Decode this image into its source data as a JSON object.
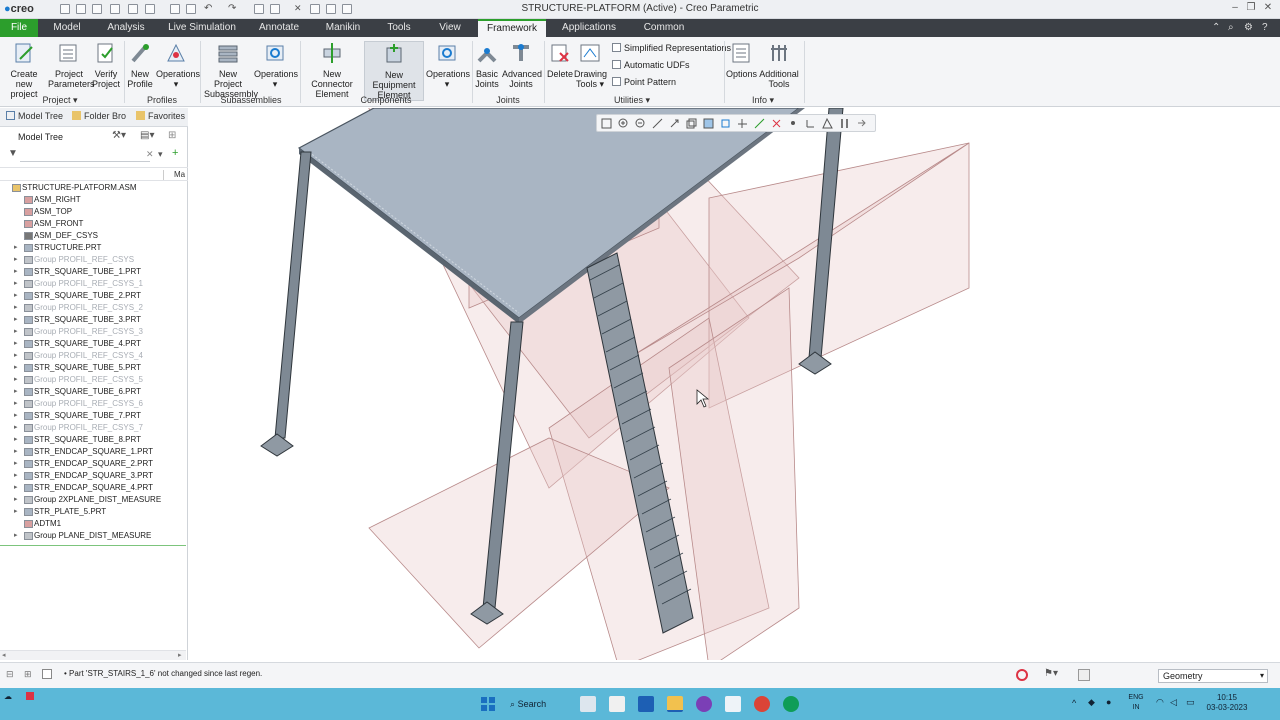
{
  "app": {
    "logo": "creo",
    "window_title": "STRUCTURE-PLATFORM (Active) - Creo Parametric"
  },
  "menu_tabs": [
    "File",
    "Model",
    "Analysis",
    "Live Simulation",
    "Annotate",
    "Manikin",
    "Tools",
    "View",
    "Framework",
    "Applications",
    "Common"
  ],
  "active_tab": "Framework",
  "ribbon": {
    "project": {
      "create_new_project": "Create new project",
      "project_parameters": "Project Parameters",
      "verify_project": "Verify Project",
      "label": "Project"
    },
    "profiles": {
      "new_profile": "New Profile",
      "operations": "Operations",
      "label": "Profiles"
    },
    "subassemblies": {
      "new_project_subassembly": "New Project Subassembly",
      "operations": "Operations",
      "label": "Subassemblies"
    },
    "components": {
      "new_connector_element": "New Connector Element",
      "new_equipment_element": "New Equipment Element",
      "operations": "Operations",
      "label": "Components"
    },
    "joints": {
      "basic_joints": "Basic Joints",
      "advanced_joints": "Advanced Joints",
      "label": "Joints"
    },
    "utilities": {
      "delete": "Delete",
      "drawing_tools": "Drawing Tools",
      "simplified_representations": "Simplified Representations",
      "automatic_udfs": "Automatic UDFs",
      "point_pattern": "Point Pattern",
      "label": "Utilities"
    },
    "info": {
      "options": "Options",
      "additional_tools": "Additional Tools",
      "label": "Info"
    }
  },
  "tree_panel": {
    "tabs": [
      "Model Tree",
      "Folder Bro",
      "Favorites"
    ],
    "header": "Model Tree",
    "column": "Ma",
    "search_value": "",
    "items": [
      {
        "label": "STRUCTURE-PLATFORM.ASM",
        "dim": false,
        "expandable": false,
        "kind": "asm"
      },
      {
        "label": "ASM_RIGHT",
        "dim": false,
        "expandable": false,
        "kind": "plane"
      },
      {
        "label": "ASM_TOP",
        "dim": false,
        "expandable": false,
        "kind": "plane"
      },
      {
        "label": "ASM_FRONT",
        "dim": false,
        "expandable": false,
        "kind": "plane"
      },
      {
        "label": "ASM_DEF_CSYS",
        "dim": false,
        "expandable": false,
        "kind": "csys"
      },
      {
        "label": "STRUCTURE.PRT",
        "dim": false,
        "expandable": true,
        "kind": "part"
      },
      {
        "label": "Group PROFIL_REF_CSYS",
        "dim": true,
        "expandable": true,
        "kind": "group"
      },
      {
        "label": "STR_SQUARE_TUBE_1.PRT",
        "dim": false,
        "expandable": true,
        "kind": "part"
      },
      {
        "label": "Group PROFIL_REF_CSYS_1",
        "dim": true,
        "expandable": true,
        "kind": "group"
      },
      {
        "label": "STR_SQUARE_TUBE_2.PRT",
        "dim": false,
        "expandable": true,
        "kind": "part"
      },
      {
        "label": "Group PROFIL_REF_CSYS_2",
        "dim": true,
        "expandable": true,
        "kind": "group"
      },
      {
        "label": "STR_SQUARE_TUBE_3.PRT",
        "dim": false,
        "expandable": true,
        "kind": "part"
      },
      {
        "label": "Group PROFIL_REF_CSYS_3",
        "dim": true,
        "expandable": true,
        "kind": "group"
      },
      {
        "label": "STR_SQUARE_TUBE_4.PRT",
        "dim": false,
        "expandable": true,
        "kind": "part"
      },
      {
        "label": "Group PROFIL_REF_CSYS_4",
        "dim": true,
        "expandable": true,
        "kind": "group"
      },
      {
        "label": "STR_SQUARE_TUBE_5.PRT",
        "dim": false,
        "expandable": true,
        "kind": "part"
      },
      {
        "label": "Group PROFIL_REF_CSYS_5",
        "dim": true,
        "expandable": true,
        "kind": "group"
      },
      {
        "label": "STR_SQUARE_TUBE_6.PRT",
        "dim": false,
        "expandable": true,
        "kind": "part"
      },
      {
        "label": "Group PROFIL_REF_CSYS_6",
        "dim": true,
        "expandable": true,
        "kind": "group"
      },
      {
        "label": "STR_SQUARE_TUBE_7.PRT",
        "dim": false,
        "expandable": true,
        "kind": "part"
      },
      {
        "label": "Group PROFIL_REF_CSYS_7",
        "dim": true,
        "expandable": true,
        "kind": "group"
      },
      {
        "label": "STR_SQUARE_TUBE_8.PRT",
        "dim": false,
        "expandable": true,
        "kind": "part"
      },
      {
        "label": "STR_ENDCAP_SQUARE_1.PRT",
        "dim": false,
        "expandable": true,
        "kind": "part"
      },
      {
        "label": "STR_ENDCAP_SQUARE_2.PRT",
        "dim": false,
        "expandable": true,
        "kind": "part"
      },
      {
        "label": "STR_ENDCAP_SQUARE_3.PRT",
        "dim": false,
        "expandable": true,
        "kind": "part"
      },
      {
        "label": "STR_ENDCAP_SQUARE_4.PRT",
        "dim": false,
        "expandable": true,
        "kind": "part"
      },
      {
        "label": "Group 2XPLANE_DIST_MEASURE",
        "dim": false,
        "expandable": true,
        "kind": "group"
      },
      {
        "label": "STR_PLATE_5.PRT",
        "dim": false,
        "expandable": true,
        "kind": "part"
      },
      {
        "label": "ADTM1",
        "dim": false,
        "expandable": false,
        "kind": "plane"
      },
      {
        "label": "Group PLANE_DIST_MEASURE",
        "dim": false,
        "expandable": true,
        "kind": "group"
      }
    ]
  },
  "status": {
    "message": "Part 'STR_STAIRS_1_6' not changed since last regen.",
    "filter": "Geometry"
  },
  "taskbar": {
    "search": "Search",
    "lang_line1": "ENG",
    "lang_line2": "IN",
    "time": "10:15",
    "date": "03-03-2023"
  },
  "colors": {
    "file_tab": "#2c9e2c",
    "tab_bar": "#3b3f45",
    "taskbar": "#5bb8d8",
    "platform_top": "#a9b5c3",
    "datum_plane": "#e8c9c9"
  }
}
